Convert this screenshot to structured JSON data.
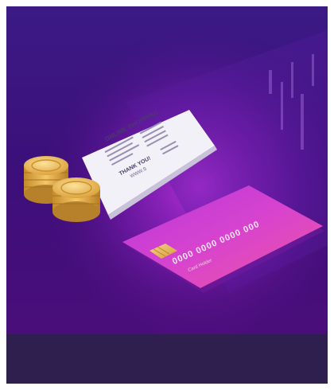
{
  "illustration": {
    "receipt": {
      "header": "ONLINE SHOPPING",
      "footer_line1": "THANK YOU!",
      "footer_line2": "WWW.S"
    },
    "credit_card": {
      "number": "0000 0000 0000 000",
      "holder": "Card Holder"
    },
    "icons": [
      "coin-stack-icon",
      "receipt-icon",
      "credit-card-icon",
      "chip-icon"
    ],
    "colors": {
      "background_top": "#3a1478",
      "background_glow": "#b31fd6",
      "card_start": "#c23bd4",
      "card_end": "#ea4cc1",
      "coin": "#e8b34a",
      "caption_bar": "#2f1f4f"
    }
  }
}
